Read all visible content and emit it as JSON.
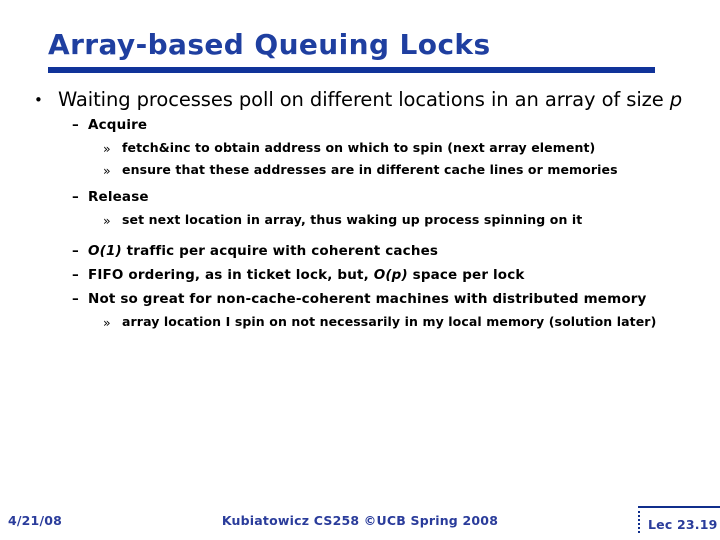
{
  "slide": {
    "title": "Array-based Queuing Locks",
    "accent_color": "#1F3FA0",
    "rule_color": "#103399",
    "body_color": "#000000",
    "footer_color": "#2A3C9B",
    "background_color": "#FFFFFF"
  },
  "bullets": {
    "b1_marker": "•",
    "b1_text_a": "Waiting processes poll on different locations in an array of size ",
    "b1_text_italic": "p",
    "b2a_marker": "–",
    "b2a_text": "Acquire",
    "b3a_marker": "»",
    "b3a_text": "fetch&inc to obtain address on which to spin (next array element)",
    "b3b_marker": "»",
    "b3b_text": "ensure that these addresses are in different cache lines or memories",
    "b2b_marker": "–",
    "b2b_text": "Release",
    "b3c_marker": "»",
    "b3c_text": "set next location in array, thus waking up process spinning on it",
    "b2c_marker": "–",
    "b2c_italic": "O(1)",
    "b2c_text": " traffic per acquire with coherent caches",
    "b2d_marker": "–",
    "b2d_text_a": "FIFO ordering, as in ticket lock, but, ",
    "b2d_italic": "O(p)",
    "b2d_text_b": " space per lock",
    "b2e_marker": "–",
    "b2e_text": "Not so great for non-cache-coherent machines with distributed memory",
    "b3d_marker": "»",
    "b3d_text": "array location  I spin on not necessarily in my local memory (solution later)"
  },
  "footer": {
    "date": "4/21/08",
    "center": "Kubiatowicz CS258 ©UCB Spring 2008",
    "lecture": "Lec 23.19"
  }
}
